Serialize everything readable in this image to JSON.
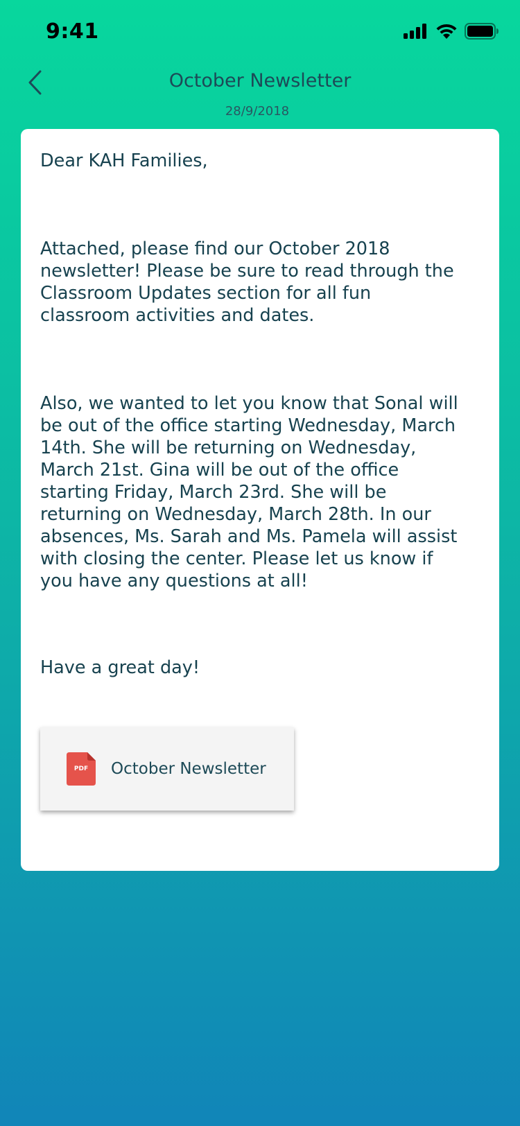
{
  "status_bar": {
    "time": "9:41"
  },
  "header": {
    "title": "October Newsletter",
    "date": "28/9/2018"
  },
  "letter": {
    "greeting": "Dear KAH Families,",
    "paragraph_1": "Attached, please find our October 2018\nnewsletter!  Please be sure to read through the\nClassroom Updates section for all fun\nclassroom activities and dates.",
    "paragraph_2": "Also, we wanted to let you know that Sonal will\nbe out of the office starting Wednesday, March\n14th.  She will be returning on Wednesday,\nMarch 21st.  Gina will be out of the office\nstarting Friday, March 23rd.  She will be\nreturning on Wednesday, March 28th.  In our\nabsences, Ms. Sarah and Ms. Pamela will assist\nwith closing the center.  Please let us know if\nyou have any questions at all!",
    "closing": "Have a great day!"
  },
  "attachment": {
    "icon": "pdf-file-icon",
    "icon_label": "PDF",
    "name": "October Newsletter"
  },
  "colors": {
    "gradient_top": "#08d79d",
    "gradient_bottom": "#1185b8",
    "text_primary": "#17424f",
    "pdf_red": "#e5534b"
  }
}
